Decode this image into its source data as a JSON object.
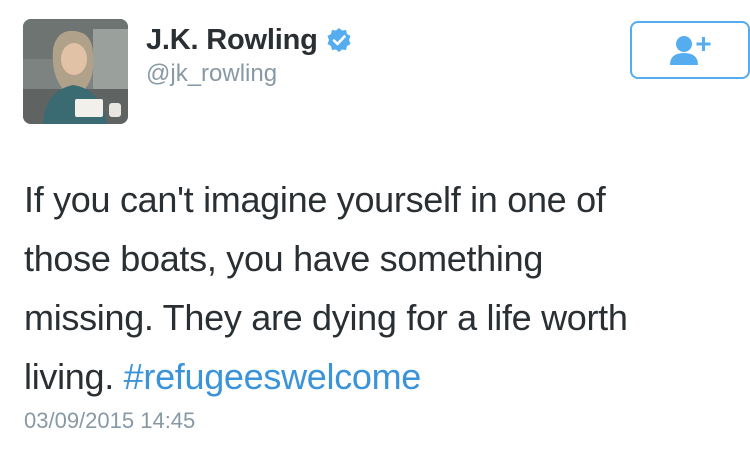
{
  "author": {
    "display_name": "J.K. Rowling",
    "handle": "@jk_rowling",
    "verified": true,
    "verified_icon": "verified-badge-icon",
    "avatar_icon": "profile-photo"
  },
  "follow_button": {
    "icon": "add-user-icon"
  },
  "tweet": {
    "lines": [
      "If you can't imagine yourself in one of",
      "those boats, you have something",
      "missing. They are dying for a life worth",
      "living. "
    ],
    "hashtag": "#refugeeswelcome",
    "timestamp": "03/09/2015 14:45"
  },
  "colors": {
    "accent": "#55acee",
    "hashtag": "#3b94d9",
    "text": "#292f33",
    "muted": "#8899a6"
  }
}
